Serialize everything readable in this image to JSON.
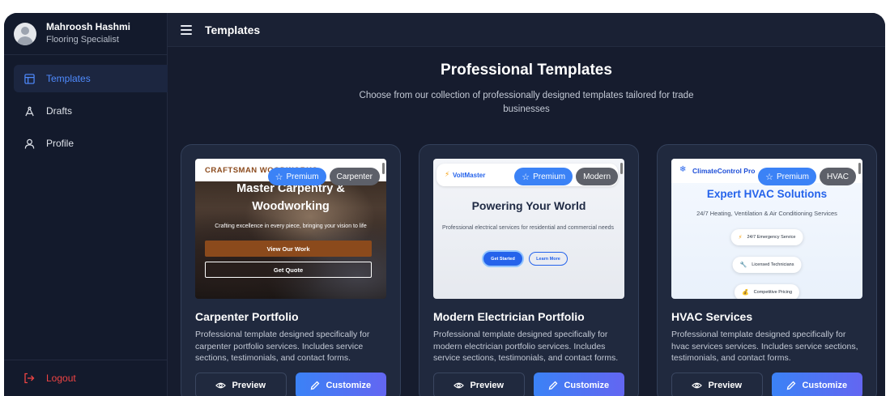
{
  "user": {
    "name": "Mahroosh Hashmi",
    "role": "Flooring Specialist"
  },
  "sidebar": {
    "items": [
      {
        "label": "Templates",
        "icon": "layout-icon",
        "active": true
      },
      {
        "label": "Drafts",
        "icon": "drafting-compass-icon",
        "active": false
      },
      {
        "label": "Profile",
        "icon": "user-icon",
        "active": false
      }
    ],
    "logout_label": "Logout"
  },
  "header": {
    "title": "Templates"
  },
  "hero": {
    "title": "Professional Templates",
    "subtitle": "Choose from our collection of professionally designed templates tailored for trade businesses"
  },
  "cards": [
    {
      "badge_premium": "Premium",
      "badge_category": "Carpenter",
      "title": "Carpenter Portfolio",
      "description": "Professional template designed specifically for carpenter portfolio services. Includes service sections, testimonials, and contact forms.",
      "preview_label": "Preview",
      "customize_label": "Customize",
      "thumb": {
        "brand": "CRAFTSMAN WOODWORKS",
        "heading_line1": "Master Carpentry &",
        "heading_line2": "Woodworking",
        "tagline": "Crafting excellence in every piece, bringing your vision to life",
        "primary_button": "View Our Work",
        "secondary_button": "Get Quote"
      }
    },
    {
      "badge_premium": "Premium",
      "badge_category": "Modern",
      "title": "Modern Electrician Portfolio",
      "description": "Professional template designed specifically for modern electrician portfolio services. Includes service sections, testimonials, and contact forms.",
      "preview_label": "Preview",
      "customize_label": "Customize",
      "thumb": {
        "brand": "VoltMaster",
        "heading": "Powering Your World",
        "tagline": "Professional electrical services for residential and commercial needs",
        "primary_button": "Get Started",
        "secondary_button": "Learn More"
      }
    },
    {
      "badge_premium": "Premium",
      "badge_category": "HVAC",
      "title": "HVAC Services",
      "description": "Professional template designed specifically for hvac services services. Includes service sections, testimonials, and contact forms.",
      "preview_label": "Preview",
      "customize_label": "Customize",
      "thumb": {
        "brand": "ClimateControl Pro",
        "heading": "Expert HVAC Solutions",
        "tagline": "24/7 Heating, Ventilation & Air Conditioning Services",
        "features": [
          "24/7 Emergency Service",
          "Licensed Technicians",
          "Competitive Pricing"
        ]
      }
    }
  ],
  "colors": {
    "background": "#161c2e",
    "sidebar": "#131a2c",
    "card": "#20293e",
    "accent": "#3b82f6",
    "active_nav_text": "#4f8bff",
    "logout": "#ef4444"
  }
}
